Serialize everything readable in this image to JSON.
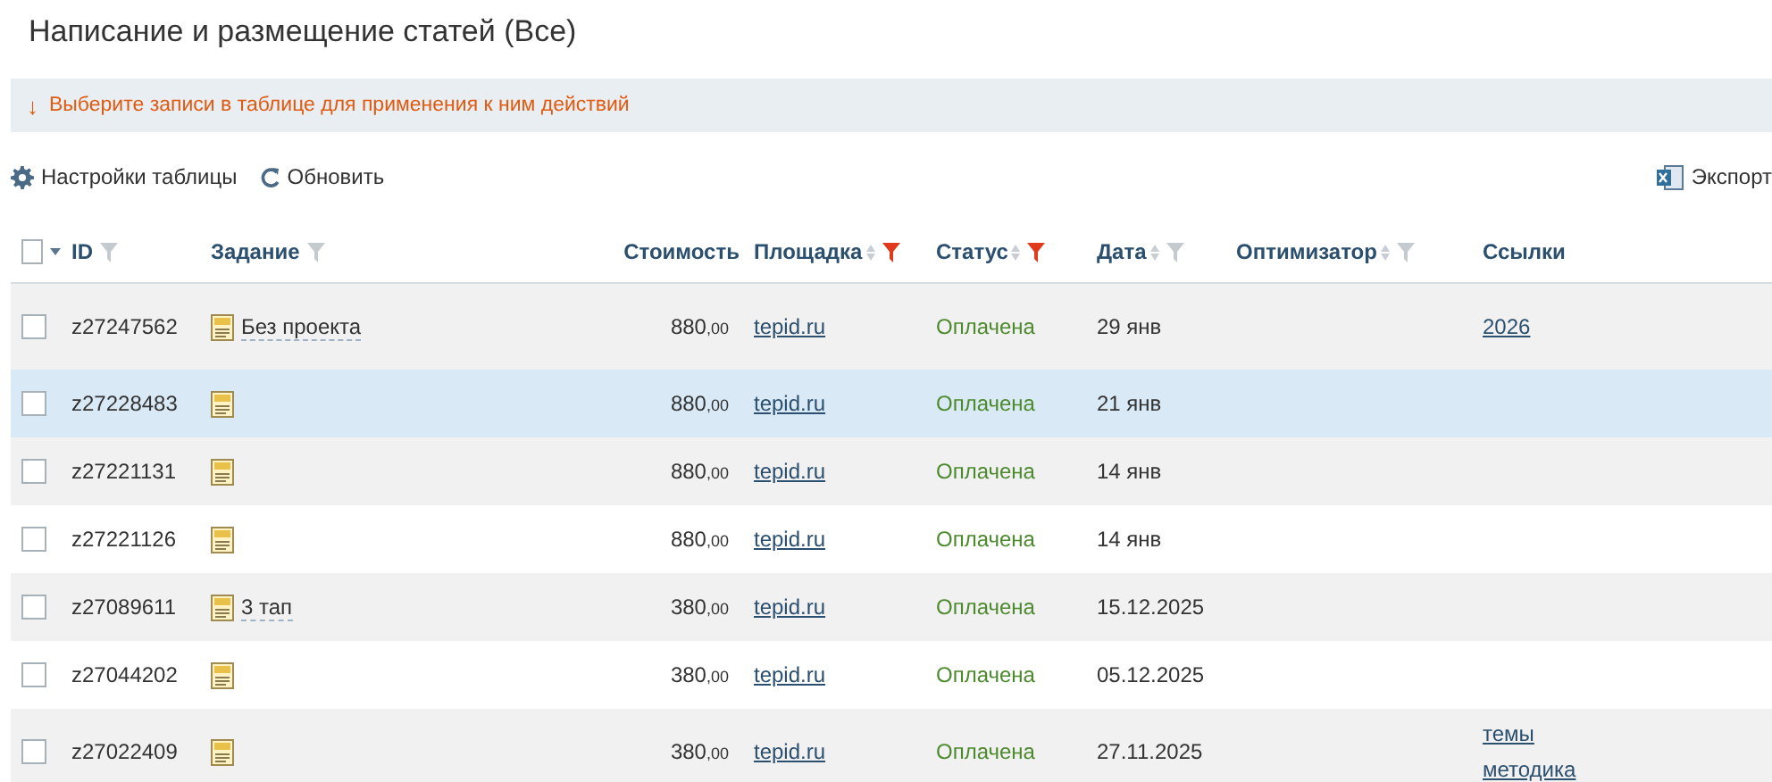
{
  "page": {
    "title": "Написание и размещение статей (Все)"
  },
  "notice": {
    "arrow": "↓",
    "text": "Выберите записи в таблице для применения к ним действий"
  },
  "toolbar": {
    "settings": "Настройки таблицы",
    "refresh": "Обновить",
    "export": "Экспорт"
  },
  "table": {
    "select_all_checked": false,
    "columns": [
      {
        "label": "ID",
        "sortable": false,
        "filterable": true,
        "filter_active": false,
        "numeric": false
      },
      {
        "label": "Задание",
        "sortable": false,
        "filterable": true,
        "filter_active": false,
        "numeric": false
      },
      {
        "label": "Стоимость",
        "sortable": false,
        "filterable": false,
        "numeric": true
      },
      {
        "label": "Площадка",
        "sortable": true,
        "filterable": true,
        "filter_active": true,
        "numeric": false
      },
      {
        "label": "Статус",
        "sortable": true,
        "filterable": true,
        "filter_active": true,
        "numeric": false
      },
      {
        "label": "Дата",
        "sortable": true,
        "filterable": true,
        "filter_active": false,
        "numeric": false
      },
      {
        "label": "Оптимизатор",
        "sortable": true,
        "filterable": true,
        "filter_active": false,
        "numeric": false
      },
      {
        "label": "Ссылки",
        "sortable": false,
        "filterable": false,
        "numeric": false
      }
    ],
    "rows": [
      {
        "checked": false,
        "selected": false,
        "id": "z27247562",
        "task": "Без проекта",
        "price": "880",
        "cents": ",00",
        "site": "tepid.ru",
        "status": "Оплачена",
        "date": "29 янв",
        "links": [
          "2026"
        ]
      },
      {
        "checked": false,
        "selected": true,
        "id": "z27228483",
        "task": "",
        "price": "880",
        "cents": ",00",
        "site": "tepid.ru",
        "status": "Оплачена",
        "date": "21 янв",
        "links": []
      },
      {
        "checked": false,
        "selected": false,
        "id": "z27221131",
        "task": "",
        "price": "880",
        "cents": ",00",
        "site": "tepid.ru",
        "status": "Оплачена",
        "date": "14 янв",
        "links": []
      },
      {
        "checked": false,
        "selected": false,
        "id": "z27221126",
        "task": "",
        "price": "880",
        "cents": ",00",
        "site": "tepid.ru",
        "status": "Оплачена",
        "date": "14 янв",
        "links": []
      },
      {
        "checked": false,
        "selected": false,
        "id": "z27089611",
        "task": "3 тап",
        "price": "380",
        "cents": ",00",
        "site": "tepid.ru",
        "status": "Оплачена",
        "date": "15.12.2025",
        "links": []
      },
      {
        "checked": false,
        "selected": false,
        "id": "z27044202",
        "task": "",
        "price": "380",
        "cents": ",00",
        "site": "tepid.ru",
        "status": "Оплачена",
        "date": "05.12.2025",
        "links": []
      },
      {
        "checked": false,
        "selected": false,
        "id": "z27022409",
        "task": "",
        "price": "380",
        "cents": ",00",
        "site": "tepid.ru",
        "status": "Оплачена",
        "date": "27.11.2025",
        "links": [
          "темы",
          "методика"
        ]
      }
    ]
  }
}
